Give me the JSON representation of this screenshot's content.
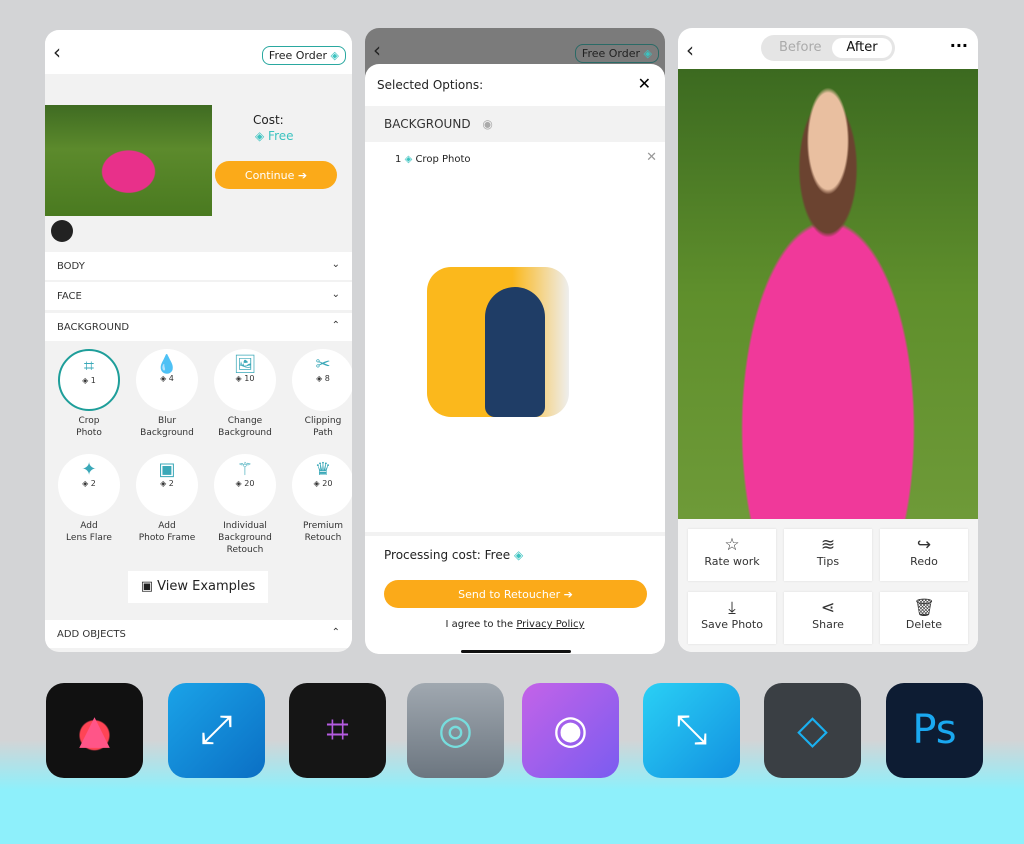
{
  "panel1": {
    "free_order": "Free Order",
    "cost_label": "Cost:",
    "cost_value": "Free",
    "continue": "Continue ➔",
    "sections": {
      "body": "BODY",
      "face": "FACE",
      "background": "BACKGROUND",
      "add_objects": "ADD OBJECTS"
    },
    "options": [
      {
        "label1": "Crop",
        "label2": "Photo",
        "cost": "1",
        "icon": "crop-icon"
      },
      {
        "label1": "Blur",
        "label2": "Background",
        "cost": "4",
        "icon": "blur-icon"
      },
      {
        "label1": "Change",
        "label2": "Background",
        "cost": "10",
        "icon": "image-icon"
      },
      {
        "label1": "Clipping",
        "label2": "Path",
        "cost": "8",
        "icon": "scissors-icon"
      },
      {
        "label1": "Add",
        "label2": "Lens Flare",
        "cost": "2",
        "icon": "sparkle-icon"
      },
      {
        "label1": "Add",
        "label2": "Photo Frame",
        "cost": "2",
        "icon": "frame-icon"
      },
      {
        "label1": "Individual",
        "label2": "Background",
        "label3": "Retouch",
        "cost": "20",
        "icon": "wand-icon"
      },
      {
        "label1": "Premium",
        "label2": "Retouch",
        "cost": "20",
        "icon": "crown-icon"
      }
    ],
    "view_examples": "View Examples"
  },
  "panel2": {
    "free_order": "Free Order",
    "title": "Selected Options:",
    "section": "BACKGROUND",
    "item_count": "1",
    "item_label": "Crop Photo",
    "processing": "Processing cost: Free",
    "send": "Send to Retoucher ➔",
    "agree": "I agree to the ",
    "privacy": "Privacy Policy"
  },
  "panel3": {
    "before": "Before",
    "after": "After",
    "tools": [
      {
        "label": "Rate work",
        "icon": "star-icon"
      },
      {
        "label": "Tips",
        "icon": "coins-icon"
      },
      {
        "label": "Redo",
        "icon": "redo-icon"
      },
      {
        "label": "Save Photo",
        "icon": "download-icon"
      },
      {
        "label": "Share",
        "icon": "share-icon"
      },
      {
        "label": "Delete",
        "icon": "trash-icon"
      }
    ]
  },
  "apps": [
    "adobe-express-icon",
    "resize-icon",
    "crop-app-icon",
    "lens-icon",
    "camera-app-icon",
    "expand-icon",
    "rotate-app-icon",
    "photoshop-express-icon"
  ],
  "colors": {
    "accent": "#fbaa19",
    "teal": "#2aa8a0"
  }
}
